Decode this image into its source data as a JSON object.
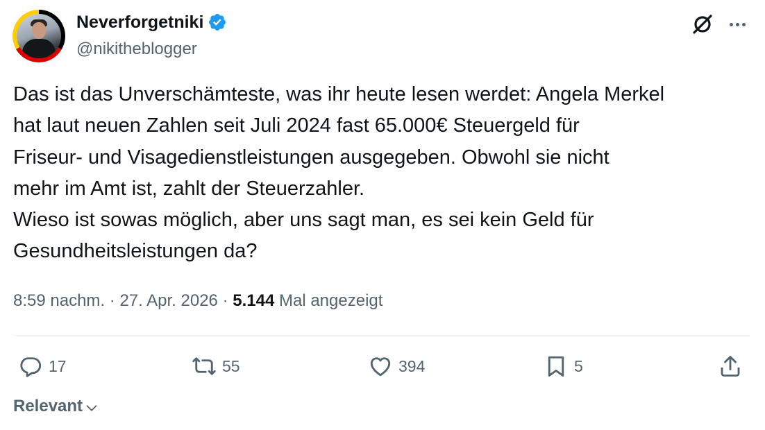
{
  "author": {
    "display_name": "Neverforgetniki",
    "handle": "@nikitheblogger",
    "verified": true
  },
  "tweet": {
    "text": "Das ist das Unverschämteste, was ihr heute lesen werdet: Angela Merkel\nhat laut neuen Zahlen seit Juli 2024 fast 65.000€ Steuergeld für\nFriseur- und Visagedienstleistungen ausgegeben. Obwohl sie nicht\nmehr im Amt ist, zahlt der Steuerzahler.\nWieso ist sowas möglich, aber uns sagt man, es sei kein Geld für\nGesundheitsleistungen da?",
    "time": "8:59 nachm.",
    "separator": "·",
    "date": "27. Apr. 2026",
    "views": "5.144",
    "views_label": "Mal angezeigt"
  },
  "actions": {
    "replies": "17",
    "reposts": "55",
    "likes": "394",
    "bookmarks": "5"
  },
  "sort": {
    "label": "Relevant"
  },
  "icons": {
    "verified": "verified-badge-icon",
    "grok": "grok-icon",
    "more": "more-dots-icon",
    "reply": "reply-icon",
    "repost": "repost-icon",
    "like": "heart-icon",
    "bookmark": "bookmark-icon",
    "share": "share-icon",
    "chevron": "chevron-down-icon"
  },
  "colors": {
    "text_primary": "#0f1419",
    "text_secondary": "#536471",
    "verified_blue": "#1d9bf0",
    "divider": "#eff3f4"
  }
}
